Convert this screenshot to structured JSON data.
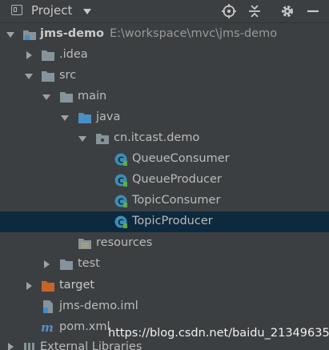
{
  "panel": {
    "title": "Project"
  },
  "tree": [
    {
      "label": "jms-demo",
      "path": "E:\\workspace\\mvc\\jms-demo",
      "icon": "module-folder-icon"
    },
    {
      "label": ".idea",
      "icon": "folder-icon"
    },
    {
      "label": "src",
      "icon": "folder-icon"
    },
    {
      "label": "main",
      "icon": "folder-icon"
    },
    {
      "label": "java",
      "icon": "source-folder-icon"
    },
    {
      "label": "cn.itcast.demo",
      "icon": "package-icon"
    },
    {
      "label": "QueueConsumer",
      "icon": "java-class-icon"
    },
    {
      "label": "QueueProducer",
      "icon": "java-class-icon"
    },
    {
      "label": "TopicConsumer",
      "icon": "java-class-icon"
    },
    {
      "label": "TopicProducer",
      "icon": "java-class-icon",
      "selected": true
    },
    {
      "label": "resources",
      "icon": "resources-folder-icon"
    },
    {
      "label": "test",
      "icon": "folder-icon"
    },
    {
      "label": "target",
      "icon": "excluded-folder-icon"
    },
    {
      "label": "jms-demo.iml",
      "icon": "iml-file-icon"
    },
    {
      "label": "pom.xml",
      "icon": "maven-icon"
    },
    {
      "label": "External Libraries",
      "icon": "libraries-icon"
    }
  ],
  "watermark": "https://blog.csdn.net/baidu_21349635",
  "colors": {
    "background": "#3c3f41",
    "selection": "#0d293e",
    "folder": "#87939a",
    "source_folder": "#4a8fc4",
    "class": "#3a8fb7",
    "excluded_folder": "#c8642a"
  }
}
